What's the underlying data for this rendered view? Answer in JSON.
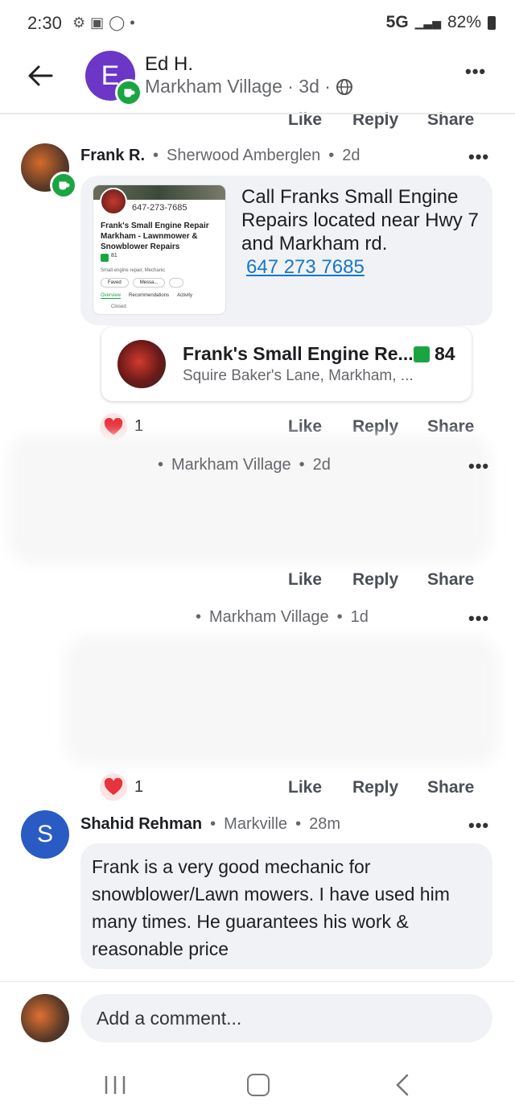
{
  "status_bar": {
    "time": "2:30",
    "network": "5G",
    "battery": "82%"
  },
  "header": {
    "avatar_letter": "E",
    "author": "Ed H.",
    "location": "Markham Village · 3d ·"
  },
  "actions": {
    "like": "Like",
    "reply": "Reply",
    "share": "Share"
  },
  "comments": [
    {
      "name": "Frank R.",
      "neighborhood": "Sherwood Amberglen",
      "age": "2d",
      "text": "Call Franks Small Engine Repairs located near Hwy 7 and Markham rd.",
      "phone_link": "647 273 7685",
      "image": {
        "phone": "647-273-7685",
        "title": "Frank's Small Engine Repair Markham - Lawnmower & Snowblower Repairs",
        "count": "81",
        "category": "Small engine repair, Mechanic",
        "buttons": [
          "Faved",
          "Messa...",
          ""
        ],
        "tabs": [
          "Overview",
          "Recommendations",
          "Activity"
        ],
        "status": "Closed"
      },
      "business": {
        "name": "Frank's Small Engine Re...",
        "count": "84",
        "address": "Squire Baker's Lane, Markham, ..."
      },
      "reactions": "1"
    },
    {
      "neighborhood": "Markham Village",
      "age": "2d"
    },
    {
      "neighborhood": "Markham Village",
      "age": "1d",
      "reactions": "1"
    },
    {
      "avatar_letter": "S",
      "name": "Shahid Rehman",
      "neighborhood": "Markville",
      "age": "28m",
      "text": "Frank is a very good mechanic for snowblower/Lawn mowers. I have used him many times. He guarantees his work & reasonable price"
    }
  ],
  "composer": {
    "placeholder": "Add a comment..."
  },
  "colors": {
    "link": "#1877c9",
    "badge_green": "#1aa541",
    "avatar_purple": "#6c36c6",
    "avatar_blue": "#2a5bc4"
  }
}
